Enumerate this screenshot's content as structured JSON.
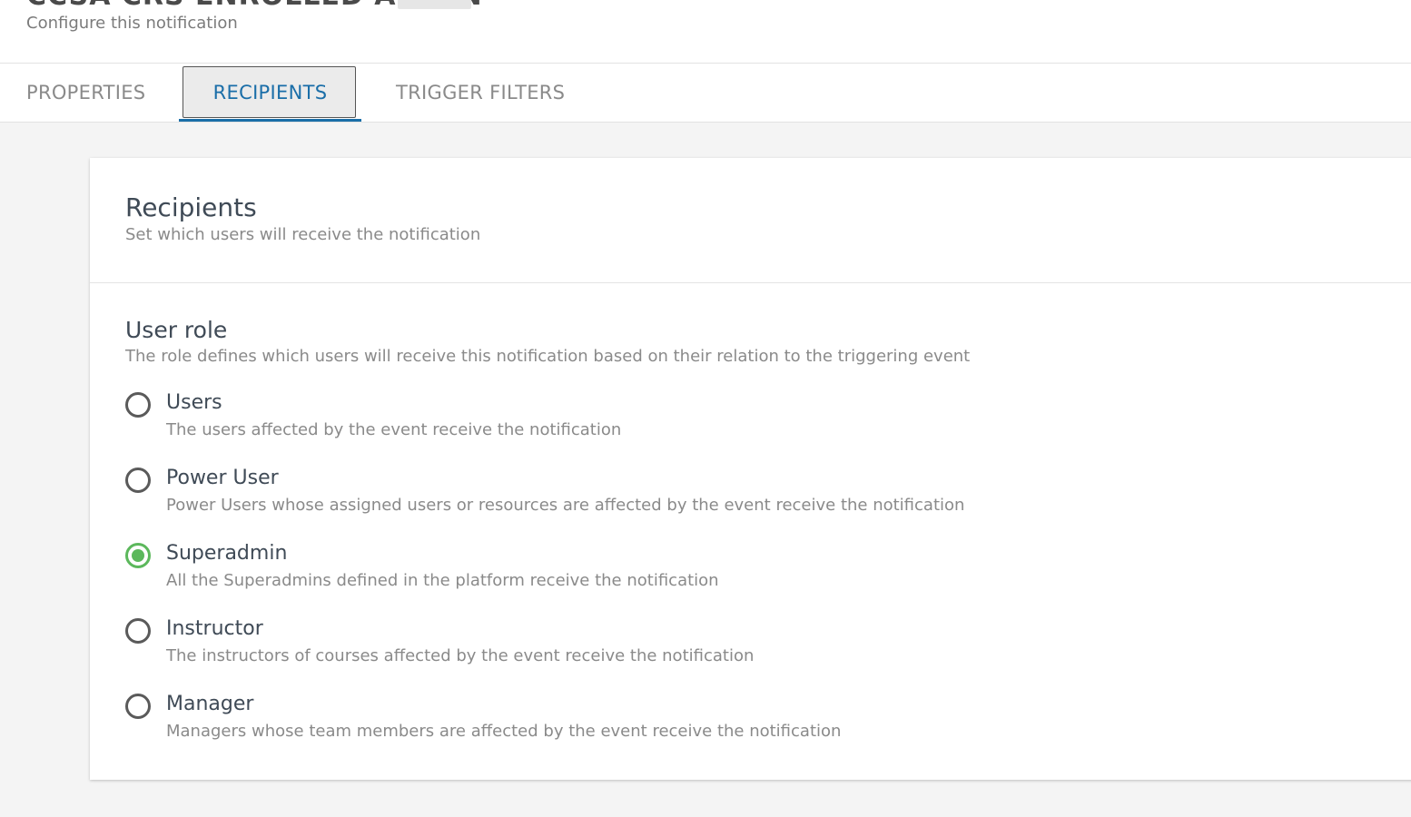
{
  "header": {
    "title": "CCSA CRS ENROLLED ADMIN",
    "subtitle": "Configure this notification"
  },
  "tabs": [
    {
      "label": "PROPERTIES",
      "active": false
    },
    {
      "label": "RECIPIENTS",
      "active": true
    },
    {
      "label": "TRIGGER FILTERS",
      "active": false
    }
  ],
  "card": {
    "title": "Recipients",
    "description": "Set which users will receive the notification",
    "role_section": {
      "title": "User role",
      "description": "The role defines which users will receive this notification based on their relation to the triggering event",
      "options": [
        {
          "label": "Users",
          "description": "The users affected by the event receive the notification",
          "selected": false
        },
        {
          "label": "Power User",
          "description": "Power Users whose assigned users or resources are affected by the event receive the notification",
          "selected": false
        },
        {
          "label": "Superadmin",
          "description": "All the Superadmins defined in the platform receive the notification",
          "selected": true
        },
        {
          "label": "Instructor",
          "description": "The instructors of courses affected by the event receive the notification",
          "selected": false
        },
        {
          "label": "Manager",
          "description": "Managers whose team members are affected by the event receive the notification",
          "selected": false
        }
      ]
    }
  },
  "colors": {
    "accent": "#1a6ea8",
    "radio_selected": "#5cb85c",
    "background": "#f4f4f4"
  }
}
